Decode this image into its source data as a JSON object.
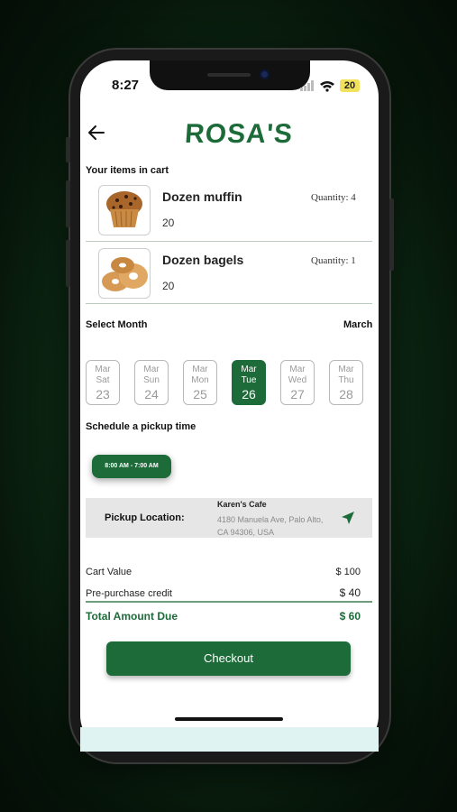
{
  "status_bar": {
    "time": "8:27",
    "battery": "20"
  },
  "header": {
    "back_icon": "arrow-left-icon",
    "brand": "ROSA'S"
  },
  "cart": {
    "title": "Your items in cart",
    "items": [
      {
        "name": "Dozen muffin",
        "price": "20",
        "quantity": "Quantity: 4",
        "image": "muffin"
      },
      {
        "name": "Dozen bagels",
        "price": "20",
        "quantity": "Quantity: 1",
        "image": "bagels"
      }
    ]
  },
  "month": {
    "label": "Select Month",
    "value": "March"
  },
  "days": [
    {
      "month": "Mar",
      "weekday": "Sat",
      "date": "23",
      "selected": false
    },
    {
      "month": "Mar",
      "weekday": "Sun",
      "date": "24",
      "selected": false
    },
    {
      "month": "Mar",
      "weekday": "Mon",
      "date": "25",
      "selected": false
    },
    {
      "month": "Mar",
      "weekday": "Tue",
      "date": "26",
      "selected": true
    },
    {
      "month": "Mar",
      "weekday": "Wed",
      "date": "27",
      "selected": false
    },
    {
      "month": "Mar",
      "weekday": "Thu",
      "date": "28",
      "selected": false
    }
  ],
  "pickup": {
    "title": "Schedule a pickup time",
    "time_slot": "8:00 AM - 7:00 AM",
    "location_label": "Pickup Location:",
    "location_name": "Karen's Cafe",
    "location_address": "4180 Manuela Ave, Palo Alto, CA 94306, USA",
    "nav_icon": "navigation-arrow-icon"
  },
  "summary": {
    "cart_value_label": "Cart Value",
    "cart_value": "$ 100",
    "credit_label": "Pre-purchase credit",
    "credit_value": "$ 40",
    "total_label": "Total Amount Due",
    "total_value": "$ 60"
  },
  "checkout_label": "Checkout",
  "colors": {
    "brand_green": "#1e6b3a",
    "background_dark": "#0d2b15"
  }
}
